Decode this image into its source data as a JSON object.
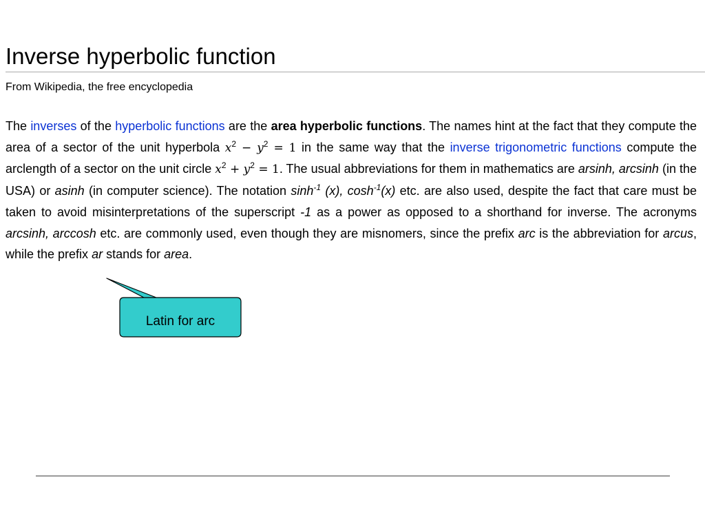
{
  "article": {
    "title": "Inverse hyperbolic function",
    "subtitle": "From Wikipedia, the free encyclopedia",
    "paragraph": {
      "t1": "The ",
      "link_inverses": "inverses",
      "t2": " of the ",
      "link_hyperbolic": "hyperbolic functions",
      "t3": " are the ",
      "bold_term": "area hyperbolic functions",
      "t4": ". The names hint at the fact that they compute the area of a sector of the unit hyperbola ",
      "eq1_x": "x",
      "eq1_op": " − ",
      "eq1_y": "y",
      "eq1_rhs": " = 1",
      "t5": " in the same way that the ",
      "link_inverse_trig": "inverse trigonometric functions",
      "t6": " compute the arclength of a sector on the unit circle ",
      "eq2_x": "x",
      "eq2_op": " + ",
      "eq2_y": "y",
      "eq2_rhs": " = 1",
      "t7": ". The usual abbreviations for them in mathematics are ",
      "i_arsinh": "arsinh, arcsinh",
      "t8": " (in the USA) or ",
      "i_asinh": "asinh",
      "t9": " (in computer science). The notation ",
      "i_sinh": "sinh",
      "sup_neg1": "-1",
      "i_x_cosh": " (x), cosh",
      "sup_neg1_b": "-1",
      "i_x": "(x)",
      "t10": " etc. are also used, despite the fact that care must be taken to avoid misinterpretations of the superscript ",
      "i_minus1": "-1",
      "t11": " as a power as opposed to a shorthand for inverse. The acronyms ",
      "i_arcsinh_arccosh": "arcsinh, arccosh",
      "t12": " etc. are commonly used, even though they are misnomers, since the prefix ",
      "i_arc": "arc",
      "t13": " is the abbreviation for ",
      "i_arcus": "arcus",
      "t14": ", while the prefix ",
      "i_ar": "ar",
      "t15": " stands for ",
      "i_area": "area",
      "t16": ".",
      "sq": "2"
    }
  },
  "callout": {
    "text": "Latin for arc",
    "fill_color": "#33cccc",
    "border_color": "#000000"
  },
  "colors": {
    "link": "#0b33d4",
    "rule": "#aaaaaa"
  }
}
